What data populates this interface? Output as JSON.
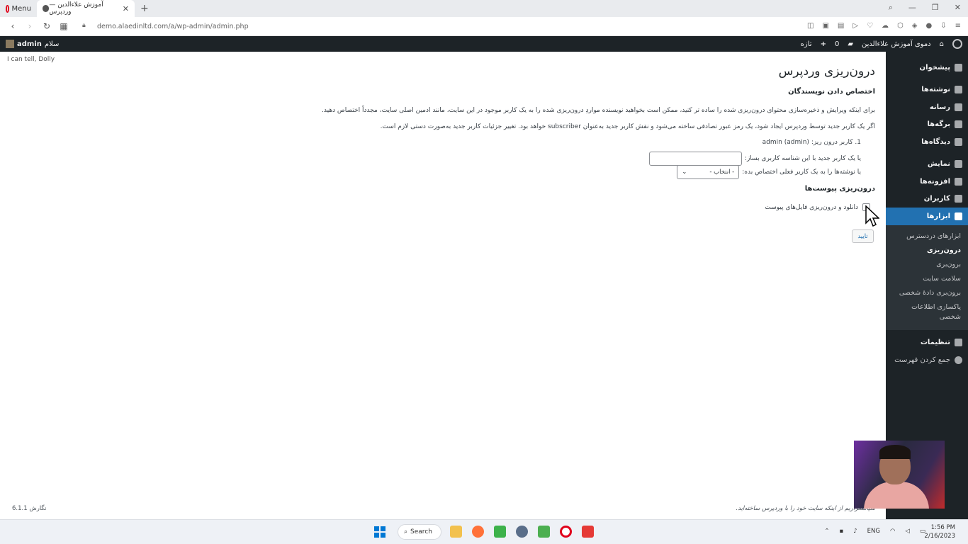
{
  "browser": {
    "tabs": [
      {
        "label": "Menu",
        "active": false
      },
      {
        "label": "آموزش علاءالدین — وردپرس",
        "active": true
      }
    ],
    "new_tab": "+",
    "url": "demo.alaedinltd.com/a/wp-admin/admin.php"
  },
  "adminbar": {
    "howdy": "سلام",
    "user": "admin",
    "site_name": "دموی آموزش علاءالدین",
    "comments_count": "0",
    "new_label": "تازه"
  },
  "sidebar": {
    "items": [
      {
        "label": "پیشخوان",
        "icon": "dashboard-icon"
      },
      {
        "label": "نوشته‌ها",
        "icon": "pin-icon"
      },
      {
        "label": "رسانه",
        "icon": "media-icon"
      },
      {
        "label": "برگه‌ها",
        "icon": "page-icon"
      },
      {
        "label": "دیدگاه‌ها",
        "icon": "comment-icon"
      },
      {
        "label": "نمایش",
        "icon": "appearance-icon"
      },
      {
        "label": "افزونه‌ها",
        "icon": "plugin-icon"
      },
      {
        "label": "کاربران",
        "icon": "users-icon"
      },
      {
        "label": "ابزارها",
        "icon": "tools-icon",
        "current": true
      }
    ],
    "submenu": [
      {
        "label": "ابزارهای دردسترس"
      },
      {
        "label": "درون‌ریزی",
        "current": true
      },
      {
        "label": "برون‌بری"
      },
      {
        "label": "سلامت سایت"
      },
      {
        "label": "برون‌بری دادهٔ شخصی"
      },
      {
        "label": "پاکسازی اطلاعات شخصی"
      }
    ],
    "after_items": [
      {
        "label": "تنظیمات",
        "icon": "settings-icon"
      },
      {
        "label": "جمع کردن فهرست",
        "icon": "collapse-icon"
      }
    ]
  },
  "content": {
    "dolly": "I can tell, Dolly",
    "title": "درون‌ریزی وردپرس",
    "assign_heading": "اختصاص دادن نویسندگان",
    "paragraph1": "برای اینکه ویرایش و ذخیره‌سازی محتوای درون‌ریزی شده را ساده تر کنید، ممکن است بخواهید نویسنده مواردِ درون‌ریزی شده را به یک کاربر موجود در این سایت، مانند ادمین اصلی سایت، مجدداً اختصاص دهید.",
    "paragraph2": "اگر یک کاربر جدید توسط وردپرس ایجاد شود، یک رمز عبور تصادفی ساخته می‌شود و نقش کاربر جدید به‌عنوان subscriber خواهد بود. تغییر جزئیات کاربر جدید به‌صورت دستی لازم است.",
    "author_item": "1. کاربر درون ریز: admin (admin)",
    "create_user_label": "یا یک کاربر جدید با این شناسه کاربری بساز:",
    "assign_existing_label": "یا نوشته‌ها را به یک کاربر فعلی اختصاص بده:",
    "select_default": "- انتخاب -",
    "attachments_heading": "درون‌ریزی پیوست‌ها",
    "attachments_label": "دانلود و درون‌ریزی فایل‌های پیوست",
    "submit_label": "تایید",
    "footer_thanks": "سپاسگزاریم از اینکه سایت خود را با وردپرس ساخته‌اید.",
    "footer_version": "نگارش 6.1.1"
  },
  "taskbar": {
    "search_label": "Search",
    "language": "ENG",
    "time": "1:56 PM",
    "date": "2/16/2023"
  }
}
